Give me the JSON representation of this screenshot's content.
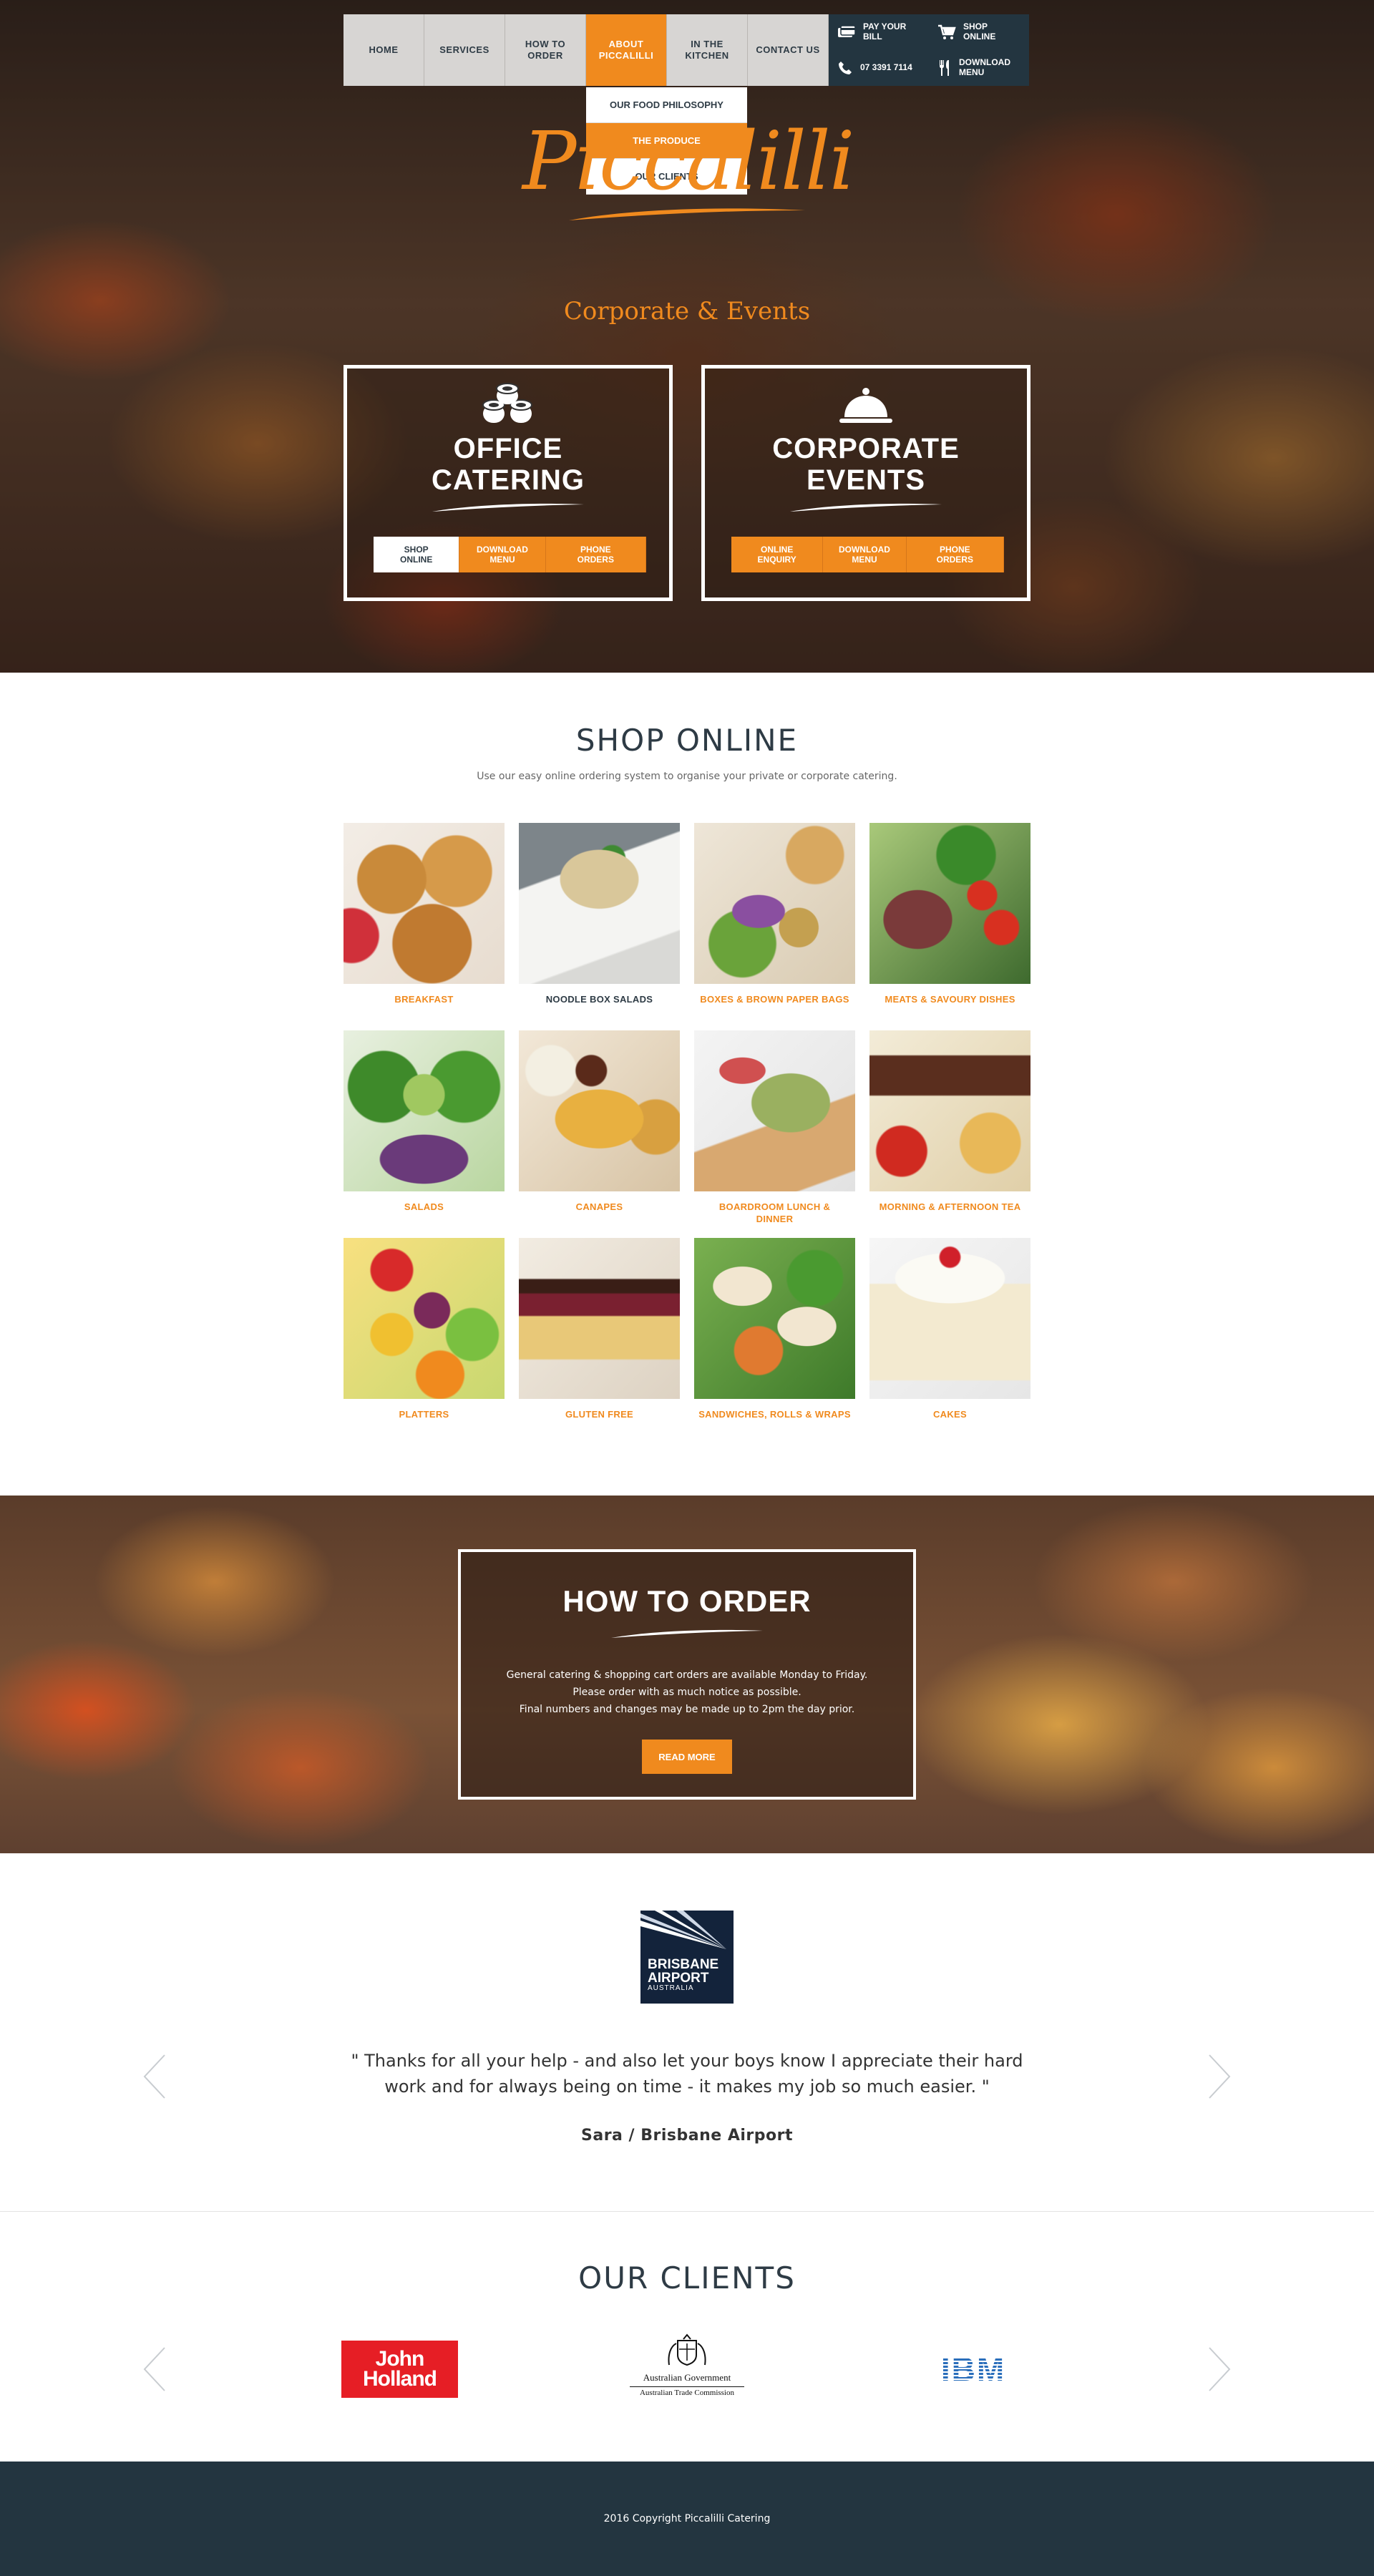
{
  "nav": {
    "items": [
      {
        "label": "HOME"
      },
      {
        "label": "SERVICES"
      },
      {
        "label": "HOW TO ORDER"
      },
      {
        "label": "ABOUT PICCALILLI",
        "active": true
      },
      {
        "label": "IN THE KITCHEN"
      },
      {
        "label": "CONTACT US"
      }
    ],
    "quick_links": {
      "pay_bill": "PAY YOUR BILL",
      "shop_online": "SHOP ONLINE",
      "phone": "07 3391 7114",
      "download_menu": "DOWNLOAD MENU"
    },
    "dropdown": [
      {
        "label": "OUR FOOD PHILOSOPHY"
      },
      {
        "label": "THE PRODUCE",
        "active": true
      },
      {
        "label": "OUR CLIENTS"
      }
    ]
  },
  "hero": {
    "logo_text": "Piccalilli",
    "tagline": "Corporate & Events",
    "office": {
      "title": "OFFICE CATERING",
      "buttons": [
        "SHOP ONLINE",
        "DOWNLOAD MENU",
        "PHONE ORDERS"
      ]
    },
    "corporate": {
      "title": "CORPORATE EVENTS",
      "buttons": [
        "ONLINE ENQUIRY",
        "DOWNLOAD MENU",
        "PHONE ORDERS"
      ]
    }
  },
  "shop": {
    "title": "SHOP ONLINE",
    "subtitle": "Use our easy online ordering system to organise your private or corporate catering.",
    "categories": [
      {
        "label": "BREAKFAST",
        "icon": "breakfast-photo"
      },
      {
        "label": "NOODLE BOX SALADS",
        "icon": "noodle-box-photo",
        "active": true
      },
      {
        "label": "BOXES & BROWN PAPER BAGS",
        "icon": "boxes-photo"
      },
      {
        "label": "MEATS & SAVOURY DISHES",
        "icon": "meats-photo"
      },
      {
        "label": "SALADS",
        "icon": "salads-photo"
      },
      {
        "label": "CANAPES",
        "icon": "canapes-photo"
      },
      {
        "label": "BOARDROOM LUNCH & DINNER",
        "icon": "boardroom-photo"
      },
      {
        "label": "MORNING & AFTERNOON TEA",
        "icon": "tea-photo"
      },
      {
        "label": "PLATTERS",
        "icon": "platters-photo"
      },
      {
        "label": "GLUTEN FREE",
        "icon": "gluten-free-photo"
      },
      {
        "label": "SANDWICHES, ROLLS & WRAPS",
        "icon": "sandwiches-photo"
      },
      {
        "label": "CAKES",
        "icon": "cakes-photo"
      }
    ]
  },
  "how_to_order": {
    "title": "HOW TO ORDER",
    "lines": [
      "General catering & shopping cart orders are available Monday to Friday.",
      "Please order with as much notice as possible.",
      "Final numbers and changes may be made up to 2pm the day prior."
    ],
    "button": "READ MORE"
  },
  "testimonial": {
    "logo_line1": "BRISBANE",
    "logo_line2": "AIRPORT",
    "logo_line3": "AUSTRALIA",
    "quote": "\" Thanks for all your help - and also let your boys know I appreciate their hard work and for always being on time - it makes my job so much easier. \"",
    "author": "Sara / Brisbane Airport"
  },
  "clients": {
    "title": "OUR CLIENTS",
    "john_holland_1": "John",
    "john_holland_2": "Holland",
    "ag_line1": "Australian Government",
    "ag_line2": "Australian Trade Commission",
    "ibm": "IBM"
  },
  "footer": {
    "copyright": "2016 Copyright Piccalilli Catering"
  },
  "colors": {
    "accent": "#f08a1e",
    "navy": "#233540",
    "text_dark": "#2e3b45"
  }
}
